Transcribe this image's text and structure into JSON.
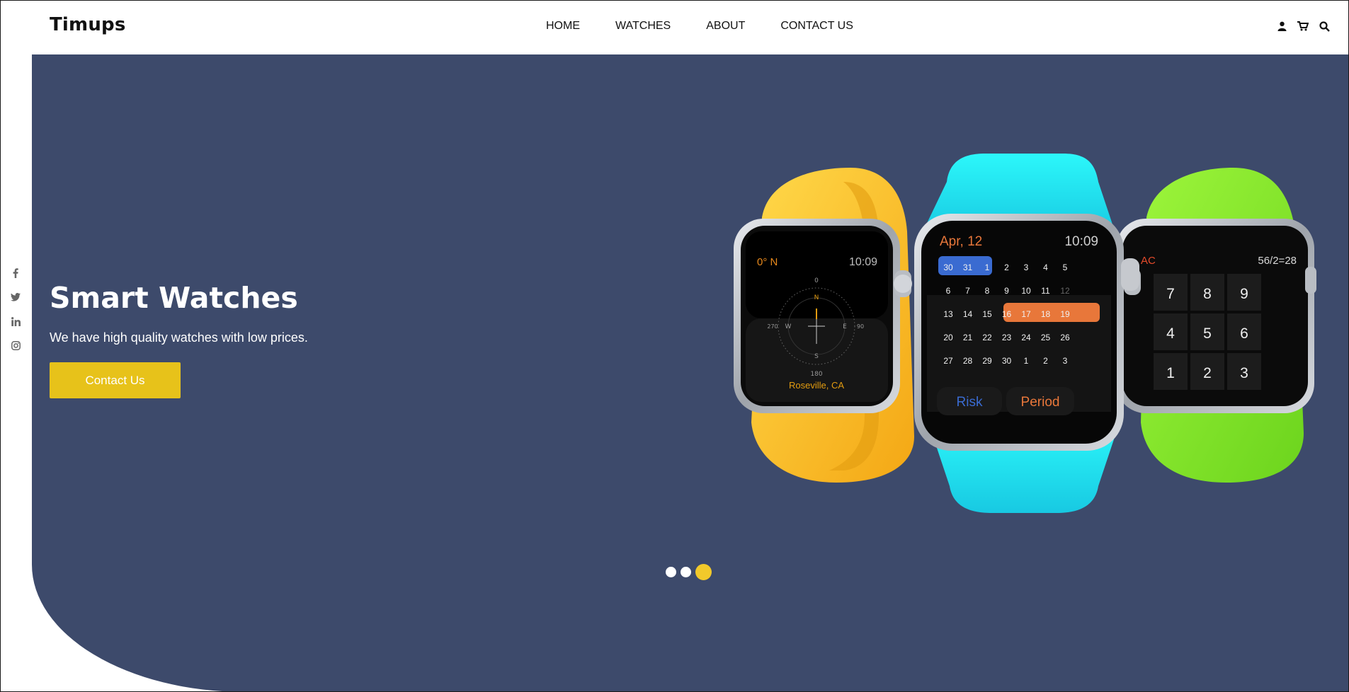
{
  "header": {
    "logo": "Timups",
    "nav": [
      "HOME",
      "WATCHES",
      "ABOUT",
      "CONTACT US"
    ],
    "icons": [
      "user-icon",
      "cart-icon",
      "search-icon"
    ]
  },
  "social": [
    "facebook-icon",
    "twitter-icon",
    "linkedin-icon",
    "instagram-icon"
  ],
  "hero": {
    "title": "Smart Watches",
    "subtitle": "We have high quality watches with low prices.",
    "button": "Contact Us",
    "background": "#3d4a6b",
    "accent": "#e7c21a"
  },
  "watch_left": {
    "band_color": "#ffc928",
    "heading": "0° N",
    "time": "10:09",
    "location": "Roseville, CA"
  },
  "watch_center": {
    "band_color": "#27f3f5",
    "date": "Apr, 12",
    "time": "10:09",
    "calendar_rows": [
      [
        "30",
        "31",
        "1",
        "2",
        "3",
        "4",
        "5"
      ],
      [
        "6",
        "7",
        "8",
        "9",
        "10",
        "11",
        "12"
      ],
      [
        "13",
        "14",
        "15",
        "16",
        "17",
        "18",
        "19"
      ],
      [
        "20",
        "21",
        "22",
        "23",
        "24",
        "25",
        "26"
      ],
      [
        "27",
        "28",
        "29",
        "30",
        "1",
        "2",
        "3"
      ]
    ],
    "btn_risk": "Risk",
    "btn_period": "Period"
  },
  "watch_right": {
    "band_color": "#8ef236",
    "ac": "AC",
    "expression": "56/2=28",
    "keys": [
      "7",
      "8",
      "9",
      "4",
      "5",
      "6",
      "1",
      "2",
      "3"
    ]
  },
  "carousel": {
    "count": 3,
    "active": 3
  }
}
